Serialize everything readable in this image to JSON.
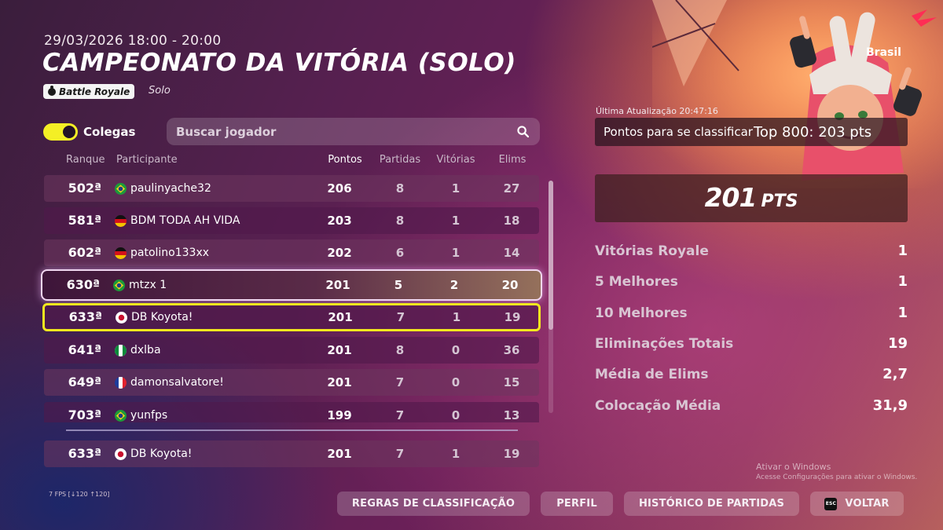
{
  "event": {
    "date": "29/03/2026 18:00 - 20:00",
    "title": "CAMPEONATO DA VITÓRIA (SOLO)",
    "mode": "Battle Royale",
    "submode": "Solo"
  },
  "filters": {
    "toggle_label": "Colegas",
    "toggle_on": true,
    "search_placeholder": "Buscar jogador"
  },
  "table": {
    "headers": {
      "rank": "Ranque",
      "participant": "Participante",
      "points": "Pontos",
      "matches": "Partidas",
      "wins": "Vitórias",
      "elims": "Elims"
    },
    "rows": [
      {
        "rank": "502ª",
        "flag": "brazil-flag",
        "name": "paulinyache32",
        "points": "206",
        "matches": "8",
        "wins": "1",
        "elims": "27"
      },
      {
        "rank": "581ª",
        "flag": "germany-flag",
        "name": "BDM TODA AH VIDA",
        "points": "203",
        "matches": "8",
        "wins": "1",
        "elims": "18"
      },
      {
        "rank": "602ª",
        "flag": "germany-flag",
        "name": "patolino133xx",
        "points": "202",
        "matches": "6",
        "wins": "1",
        "elims": "14"
      },
      {
        "rank": "630ª",
        "flag": "brazil-flag",
        "name": "mtzx 1",
        "points": "201",
        "matches": "5",
        "wins": "2",
        "elims": "20"
      },
      {
        "rank": "633ª",
        "flag": "japan-flag",
        "name": "DB Koyota!",
        "points": "201",
        "matches": "7",
        "wins": "1",
        "elims": "19"
      },
      {
        "rank": "641ª",
        "flag": "nigeria-flag",
        "name": "dxlba",
        "points": "201",
        "matches": "8",
        "wins": "0",
        "elims": "36"
      },
      {
        "rank": "649ª",
        "flag": "france-flag",
        "name": "damonsalvatore!",
        "points": "201",
        "matches": "7",
        "wins": "0",
        "elims": "15"
      },
      {
        "rank": "703ª",
        "flag": "brazil-flag",
        "name": "yunfps",
        "points": "199",
        "matches": "7",
        "wins": "0",
        "elims": "13"
      }
    ],
    "own_row": {
      "rank": "633ª",
      "flag": "japan-flag",
      "name": "DB Koyota!",
      "points": "201",
      "matches": "7",
      "wins": "1",
      "elims": "19"
    }
  },
  "panel": {
    "region": "Brasil",
    "last_update": "Última Atualização 20:47:16",
    "qualify_label": "Pontos para se classificar",
    "qualify_value": "Top 800: 203 pts",
    "total_points": "201",
    "total_unit": "PTS",
    "stats": [
      {
        "label": "Vitórias Royale",
        "value": "1"
      },
      {
        "label": "5 Melhores",
        "value": "1"
      },
      {
        "label": "10 Melhores",
        "value": "1"
      },
      {
        "label": "Eliminações Totais",
        "value": "19"
      },
      {
        "label": "Média de Elims",
        "value": "2,7"
      },
      {
        "label": "Colocação Média",
        "value": "31,9"
      }
    ]
  },
  "footer": {
    "fps": "7 FPS [↓120 ↑120]",
    "windows_line1": "Ativar o Windows",
    "windows_line2": "Acesse Configurações para ativar o Windows.",
    "buttons": {
      "rules": "REGRAS DE CLASSIFICAÇÃO",
      "profile": "PERFIL",
      "history": "HISTÓRICO DE PARTIDAS",
      "esc_key": "ESC",
      "back": "VOLTAR"
    }
  }
}
